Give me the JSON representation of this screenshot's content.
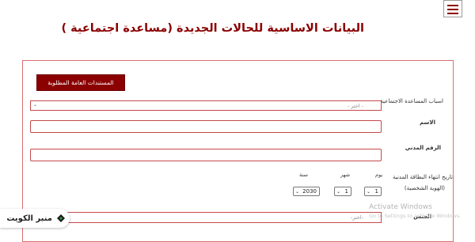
{
  "header": {
    "title": "البيانات الاساسية للحالات الجديدة (مساعدة اجتماعية )",
    "menu_icon": "hamburger-menu-icon"
  },
  "form": {
    "docs_button": "المستندات العامة المطلوبة",
    "reason_label": "اسباب المساعدة الاجتماعية",
    "reason_placeholder": "- اختر -",
    "name_label": "الاسم",
    "civil_id_label": "الرقم المدني",
    "expiry_label_line1": "تاريخ انتهاء البطاقة المدنية",
    "expiry_label_line2": "(الهوية الشخصية)",
    "day_label": "يوم",
    "month_label": "شهر",
    "year_label": "سنة",
    "day_value": "1",
    "month_value": "1",
    "year_value": "2030",
    "nationality_label": "الجنس",
    "nationality_placeholder": "-اختر-"
  },
  "watermark": {
    "title": "Activate Windows",
    "subtitle": "Go to Settings to activate Windows."
  },
  "logo": {
    "text": "منبر الكويت"
  },
  "colors": {
    "brand": "#8b0000",
    "field_border": "#c44a4a",
    "panel_border": "#d97070"
  }
}
